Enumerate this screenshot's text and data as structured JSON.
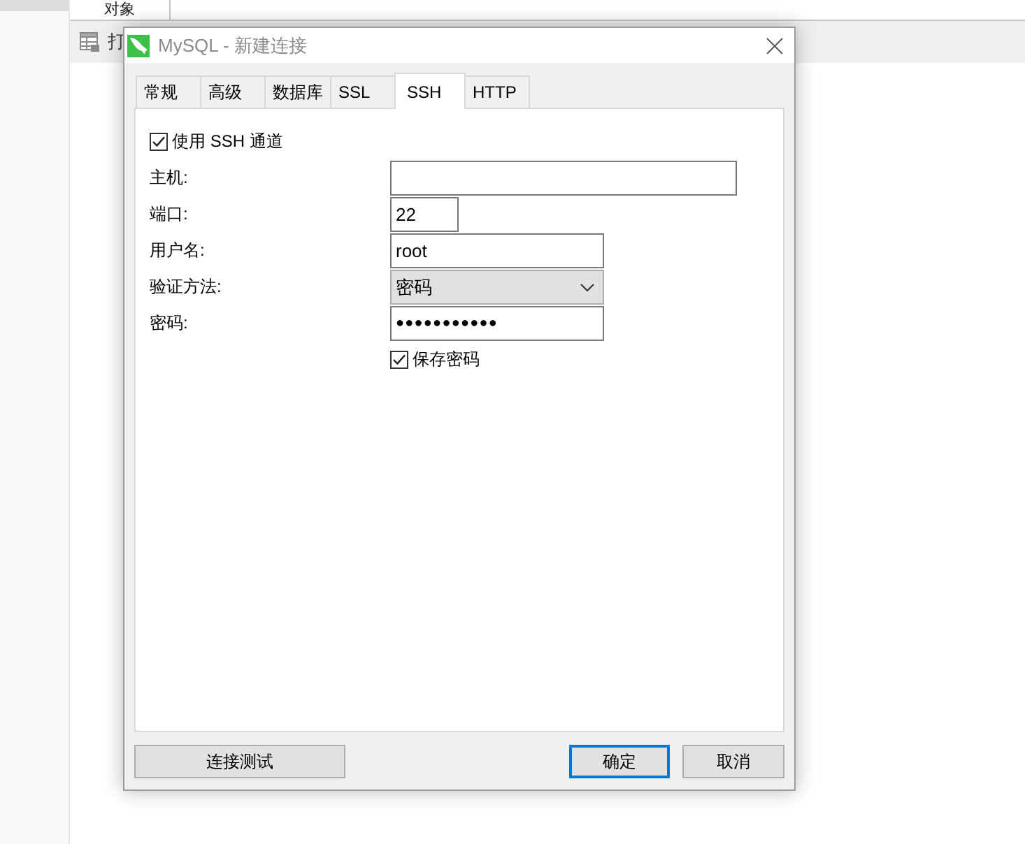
{
  "background": {
    "tabs": [
      {
        "label": "对象",
        "selected": true
      }
    ],
    "toolbar": [
      {
        "label": "打"
      }
    ]
  },
  "dialog": {
    "title": "MySQL - 新建连接",
    "tabs": [
      {
        "label": "常规",
        "selected": false
      },
      {
        "label": "高级",
        "selected": false
      },
      {
        "label": "数据库",
        "selected": false
      },
      {
        "label": "SSL",
        "selected": false
      },
      {
        "label": "SSH",
        "selected": true
      },
      {
        "label": "HTTP",
        "selected": false
      }
    ],
    "ssh_tunnel": {
      "label": "使用 SSH 通道",
      "checked": true
    },
    "fields": [
      {
        "kind": "text",
        "label": "主机:"
      },
      {
        "kind": "text",
        "label": "端口:",
        "value": "22"
      },
      {
        "kind": "text",
        "label": "用户名:",
        "value": "root"
      },
      {
        "kind": "select",
        "label": "验证方法:",
        "value": "密码"
      },
      {
        "kind": "password",
        "label": "密码:",
        "value": "●●●●●●●●●●●"
      }
    ],
    "save_password": {
      "label": "保存密码",
      "checked": true
    },
    "buttons": [
      {
        "label": "连接测试",
        "default": false
      },
      {
        "label": "确定",
        "default": true
      },
      {
        "label": "取消",
        "default": false
      }
    ]
  }
}
